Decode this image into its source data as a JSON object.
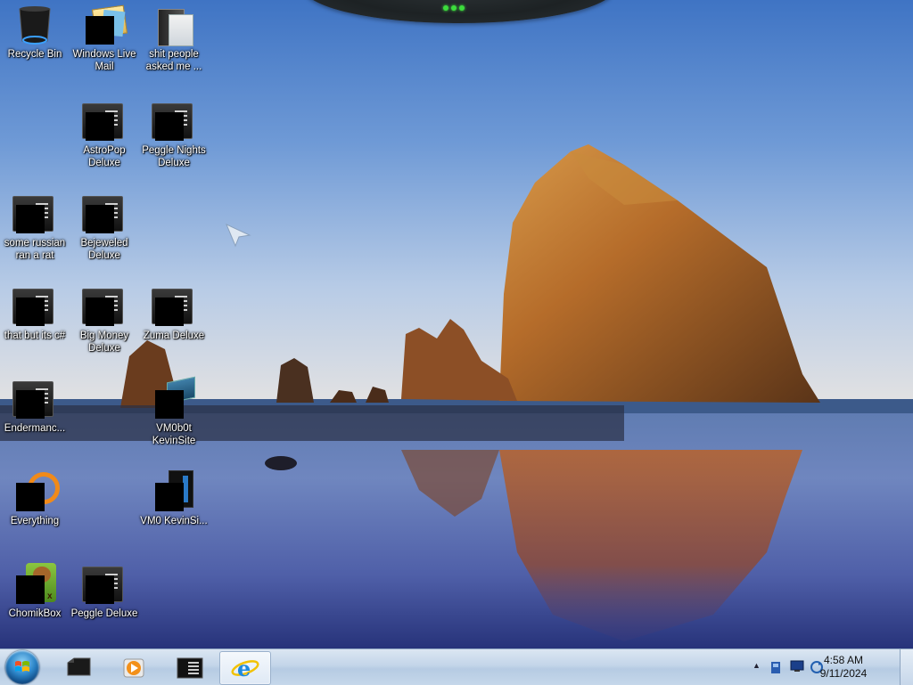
{
  "desktop": {
    "icons": [
      {
        "label": "Recycle Bin",
        "icon": "recycle-bin-icon"
      },
      {
        "label": "Windows Live Mail",
        "icon": "mail-icon"
      },
      {
        "label": "shit people asked me ...",
        "icon": "folder-icon"
      },
      {
        "label": "AstroPop Deluxe",
        "icon": "game-exe-icon"
      },
      {
        "label": "Peggle Nights Deluxe",
        "icon": "game-exe-icon"
      },
      {
        "label": "some russian ran a rat",
        "icon": "exe-icon"
      },
      {
        "label": "Bejeweled Deluxe",
        "icon": "game-exe-icon"
      },
      {
        "label": "that but its c#",
        "icon": "exe-icon"
      },
      {
        "label": "Big Money Deluxe",
        "icon": "game-exe-icon"
      },
      {
        "label": "Zuma Deluxe",
        "icon": "game-exe-icon"
      },
      {
        "label": "Endermanc...",
        "icon": "exe-icon"
      },
      {
        "label": "VM0b0t KevinSite",
        "icon": "vm-icon"
      },
      {
        "label": "Everything",
        "icon": "search-everything-icon"
      },
      {
        "label": "VM0 KevinSi...",
        "icon": "vm-icon"
      },
      {
        "label": "ChomikBox",
        "icon": "chomikbox-icon"
      },
      {
        "label": "Peggle Deluxe",
        "icon": "game-exe-icon"
      }
    ]
  },
  "taskbar": {
    "start_icon": "windows-start-orb",
    "pinned": [
      "explorer-black-icon",
      "media-player-icon",
      "console-window-icon",
      "internet-explorer-icon"
    ],
    "tray_icons": [
      "show-hidden-chevron-icon",
      "volume-icon",
      "network-icon",
      "sync-icon"
    ],
    "time": "4:58 AM",
    "date": "9/11/2024",
    "show_hidden_glyph": "▲"
  },
  "colors": {
    "taskbar": "#c3d5e9",
    "sky_top": "#3f74c4",
    "sky_bottom": "#dbe4ec"
  }
}
